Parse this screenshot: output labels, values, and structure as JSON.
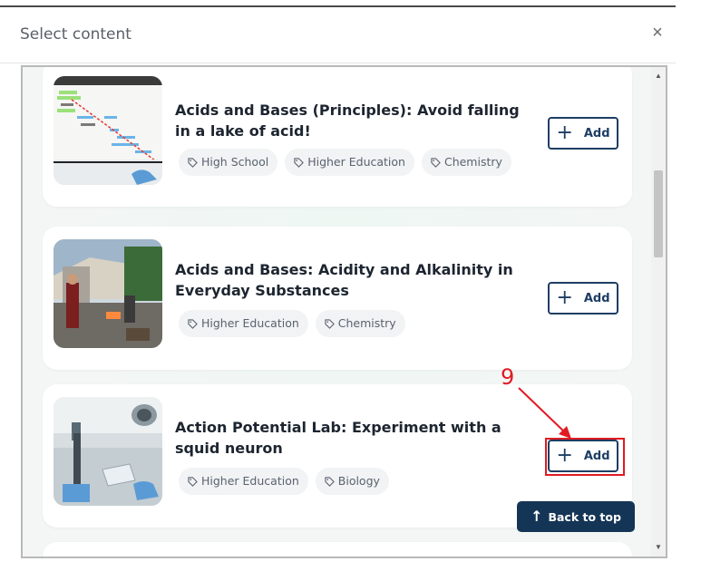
{
  "modal": {
    "title": "Select content",
    "close_label": "×"
  },
  "cards": [
    {
      "title": "Acids and Bases (Principles): Avoid falling in a lake of acid!",
      "tags": [
        "High School",
        "Higher Education",
        "Chemistry"
      ],
      "add_label": "Add"
    },
    {
      "title": "Acids and Bases: Acidity and Alkalinity in Everyday Substances",
      "tags": [
        "Higher Education",
        "Chemistry"
      ],
      "add_label": "Add"
    },
    {
      "title": "Action Potential Lab: Experiment with a squid neuron",
      "tags": [
        "Higher Education",
        "Biology"
      ],
      "add_label": "Add"
    }
  ],
  "back_to_top": "Back to top",
  "annotation": {
    "step_number": "9",
    "color": "#e01b24"
  },
  "colors": {
    "button_border": "#1e3e63",
    "back_to_top_bg": "#153556"
  }
}
